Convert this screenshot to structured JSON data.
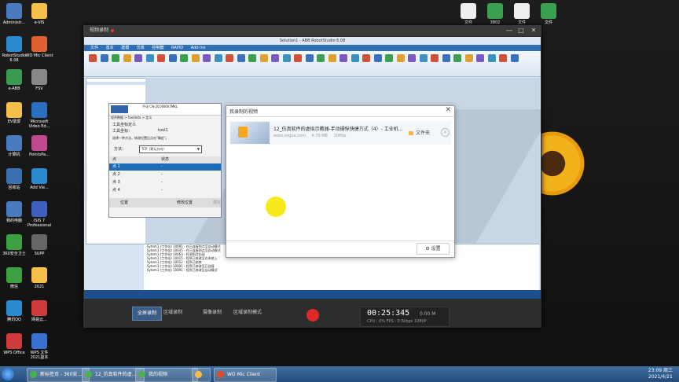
{
  "desktop": {
    "left_icons": [
      "Administr...",
      "e-VIS",
      "RobotStudio 6.08",
      "WO Mic Client",
      "e-ABB",
      "FSV",
      "EV录屏",
      "Microsoft Video Ed...",
      "计算机",
      "PointsPa...",
      "回收站",
      "Add Vie...",
      "我的电脑",
      "ISIS 7 Professional",
      "360安全卫士",
      "SUPP",
      "微信",
      "2021",
      "腾讯QQ",
      "网易云...",
      "WPS Office",
      "WPS 文件 2021副本"
    ],
    "right_icons": [
      "文件",
      "3802",
      "文件",
      "文件"
    ]
  },
  "recorder": {
    "title": "视频录制",
    "window_controls": [
      "—",
      "□",
      "✕"
    ],
    "modes": [
      {
        "label": "全屏录制",
        "active": true
      },
      {
        "label": "区域录制",
        "active": false
      },
      {
        "label": "摄像录制",
        "active": false
      },
      {
        "label": "区域录制模式",
        "active": false
      }
    ],
    "timer": "00:25:345",
    "size": "0.00 M",
    "stats": "CPU : 0%   FPS : 0   0kbps   1080P"
  },
  "robotstudio": {
    "title": "Solution1 - ABB RobotStudio 6.08",
    "menu": [
      "文件",
      "基本",
      "建模",
      "仿真",
      "控制器",
      "RAPID",
      "Add-Ins"
    ],
    "flexpendant": {
      "header": "手动  CN-20190607MKL",
      "breadcrumb": "程序数据 > tooldata > 定义",
      "section": "工具坐标定义",
      "tool_label": "工具坐标：",
      "tool_value": "tool1",
      "hint": "选择一种方法，修改位置后点击\"确定\"。",
      "method_label": "方法：",
      "method_value": "TCP（默认方向）",
      "columns": [
        "点",
        "状态"
      ],
      "rows": [
        {
          "label": "点 1",
          "status": "-"
        },
        {
          "label": "点 2",
          "status": "-"
        },
        {
          "label": "点 3",
          "status": "-"
        },
        {
          "label": "点 4",
          "status": "-"
        }
      ],
      "pos_button": "位置",
      "modify_button": "修改位置",
      "confirm_button": "确定"
    },
    "log_rows": [
      "Sytem1 (工作站) 10091 - 在已连接到点至自动模式",
      "Sytem1 (工作站) 10045 - 在已连接到点至自动模式",
      "Sytem1 (工作站) 10063 - 检测到点出现",
      "Sytem1 (工作站) 10015 - 程序已修改至在系统上",
      "Sytem1 (工作站) 10052 - 程序已结束",
      "Sytem1 (工作站) 10091 - 程序已修改至已连接",
      "Sytem1 (工作站) 10091 - 程序已修改至自动模式"
    ]
  },
  "dialog": {
    "title": "我录制的视频",
    "file_name": "12_仿真软件的虚拟示教器-手动操纵快捷方式（4）- 工业机...",
    "source": "www.ixigua.com",
    "size": "4.70 MB",
    "resolution": "1080p",
    "folder_label": "文件夹",
    "settings_label": "设置"
  },
  "taskbar": {
    "items": [
      "新标签页 - 360安...",
      "12_仿真软件的虚...",
      "我的视频",
      "",
      "WO Mic Client"
    ],
    "time": "23:09 周三",
    "date": "2021/4/21"
  },
  "colors": {
    "accent": "#3e5d86",
    "record": "#e02a2a",
    "highlight": "#f7ea1a",
    "selection": "#1e6bb8"
  }
}
